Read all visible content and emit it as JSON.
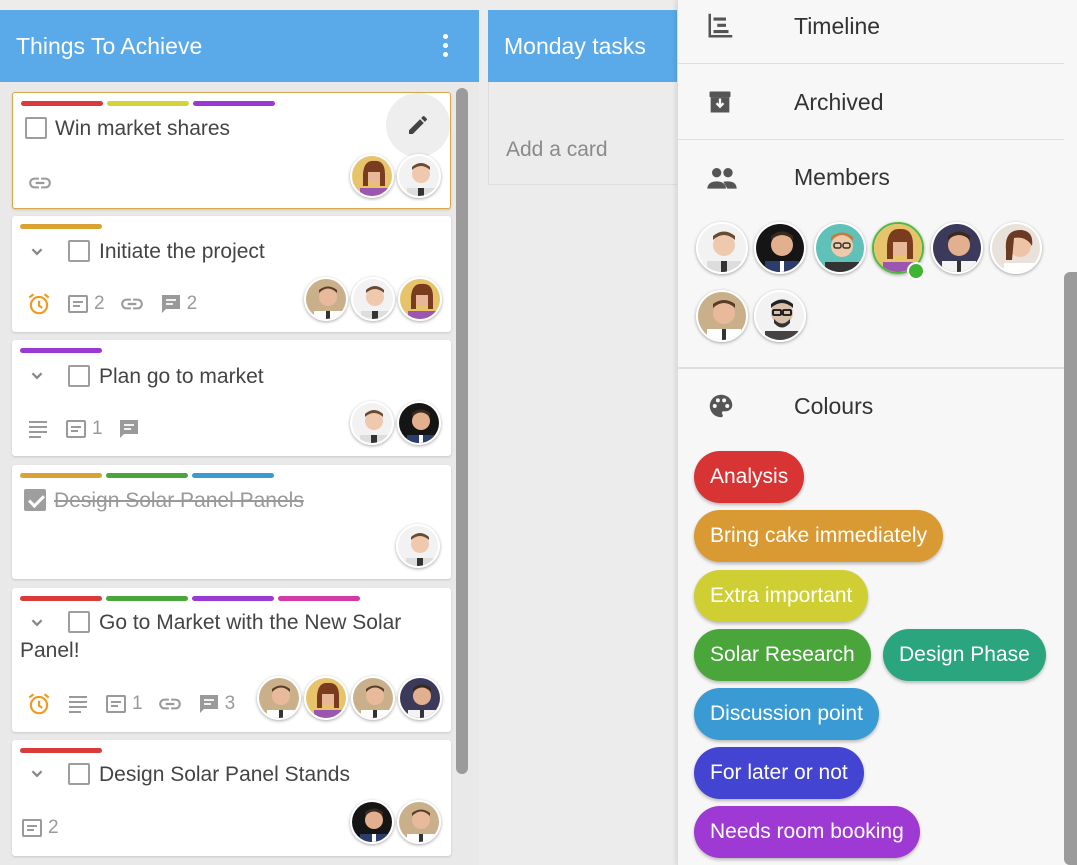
{
  "lists": [
    {
      "title": "Things To Achieve",
      "cards": [
        {
          "title": "Win market shares",
          "labels": [
            "#d93a3a",
            "#d3d33a",
            "#9a3ad3"
          ],
          "checked": false,
          "meta": [
            "link-icon"
          ]
        },
        {
          "title": "Initiate the project",
          "labels": [
            "#d9a233"
          ],
          "checked": false,
          "meta": [
            {
              "icon": "alarm-icon"
            },
            {
              "icon": "checklist-icon",
              "count": "2"
            },
            {
              "icon": "link-icon"
            },
            {
              "icon": "comment-icon",
              "count": "2"
            }
          ]
        },
        {
          "title": "Plan go to market",
          "labels": [
            "#9a3ad3"
          ],
          "checked": false,
          "meta": [
            {
              "icon": "description-icon"
            },
            {
              "icon": "checklist-icon",
              "count": "1"
            },
            {
              "icon": "comment-icon"
            }
          ]
        },
        {
          "title": "Design Solar Panel Panels",
          "labels": [
            "#d9a233",
            "#4aa63a",
            "#3a9ad3"
          ],
          "checked": true,
          "meta": []
        },
        {
          "title_line1": "Go to Market with the New Solar",
          "title_line2": "Panel!",
          "labels": [
            "#d93a3a",
            "#4aa63a",
            "#9a3ad3",
            "#d33aa6"
          ],
          "checked": false,
          "meta": [
            {
              "icon": "alarm-icon"
            },
            {
              "icon": "description-icon"
            },
            {
              "icon": "checklist-icon",
              "count": "1"
            },
            {
              "icon": "link-icon"
            },
            {
              "icon": "comment-icon",
              "count": "3"
            }
          ]
        },
        {
          "title": "Design Solar Panel Stands",
          "labels": [
            "#d93a3a"
          ],
          "checked": false,
          "meta": [
            {
              "icon": "checklist-icon",
              "count": "2"
            }
          ]
        }
      ]
    },
    {
      "title": "Monday tasks",
      "add_card": "Add a card"
    }
  ],
  "panel": {
    "timeline": "Timeline",
    "archived": "Archived",
    "members": "Members",
    "colours": "Colours",
    "colour_chips": [
      {
        "label": "Analysis",
        "color": "#d83434"
      },
      {
        "label": "Bring cake immediately",
        "color": "#d99a34"
      },
      {
        "label": "Extra important",
        "color": "#cfcf34"
      },
      {
        "label": "Solar Research",
        "color": "#4aa63a"
      },
      {
        "label": "Design Phase",
        "color": "#2aa57d"
      },
      {
        "label": "Discussion point",
        "color": "#3a9ad3"
      },
      {
        "label": "For later or not",
        "color": "#4444d3"
      },
      {
        "label": "Needs room booking",
        "color": "#9e3ad3"
      }
    ]
  },
  "colors": {
    "header_blue": "#5aa9e8",
    "alarm_orange": "#f29a1f",
    "online_green": "#3fb534"
  }
}
